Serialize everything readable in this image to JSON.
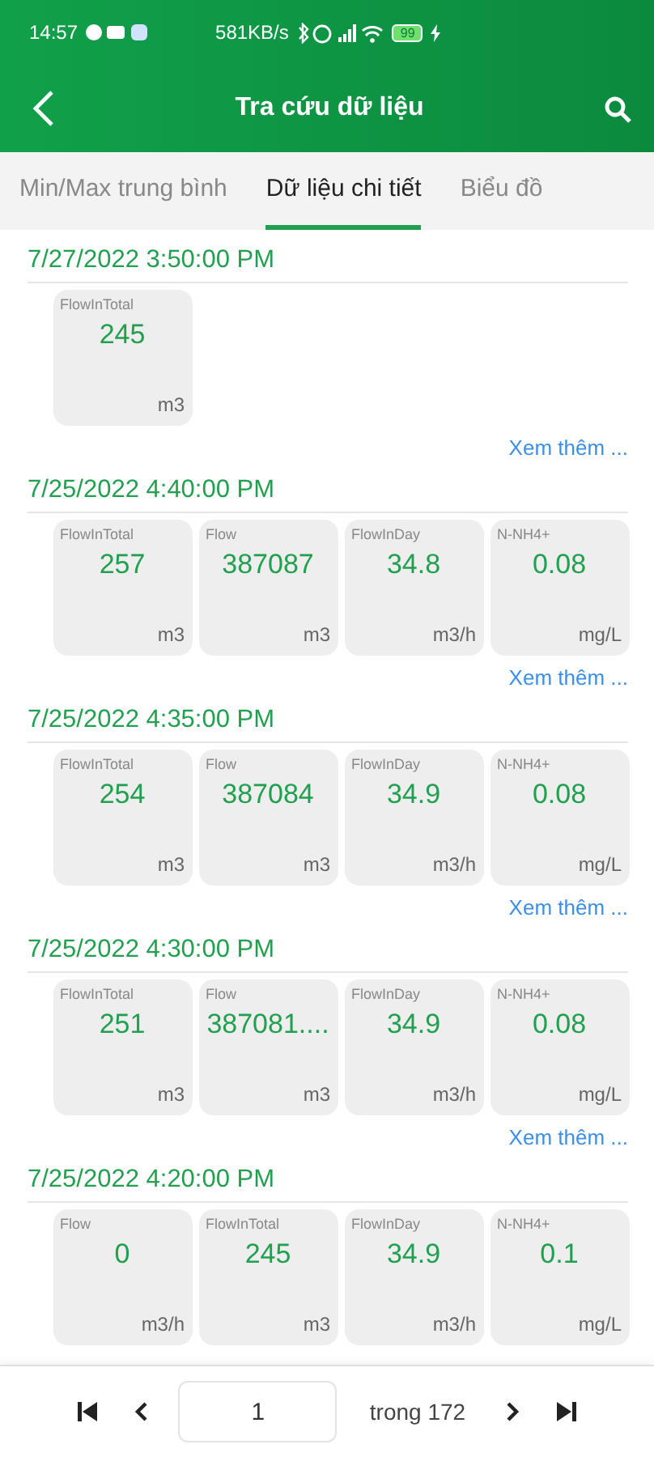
{
  "status_bar": {
    "time": "14:57",
    "speed": "581KB/s",
    "battery": "99"
  },
  "app_bar": {
    "title": "Tra cứu dữ liệu"
  },
  "tabs": [
    {
      "label": "Min/Max trung bình",
      "selected": false
    },
    {
      "label": "Dữ liệu chi tiết",
      "selected": true
    },
    {
      "label": "Biểu đồ",
      "selected": false
    }
  ],
  "records": [
    {
      "timestamp": "7/27/2022 3:50:00 PM",
      "metrics": [
        {
          "name": "FlowInTotal",
          "value": "245",
          "unit": "m3"
        }
      ],
      "more_link": "Xem thêm ..."
    },
    {
      "timestamp": "7/25/2022 4:40:00 PM",
      "metrics": [
        {
          "name": "FlowInTotal",
          "value": "257",
          "unit": "m3"
        },
        {
          "name": "Flow",
          "value": "387087",
          "unit": "m3"
        },
        {
          "name": "FlowInDay",
          "value": "34.8",
          "unit": "m3/h"
        },
        {
          "name": "N-NH4+",
          "value": "0.08",
          "unit": "mg/L"
        }
      ],
      "more_link": "Xem thêm ..."
    },
    {
      "timestamp": "7/25/2022 4:35:00 PM",
      "metrics": [
        {
          "name": "FlowInTotal",
          "value": "254",
          "unit": "m3"
        },
        {
          "name": "Flow",
          "value": "387084",
          "unit": "m3"
        },
        {
          "name": "FlowInDay",
          "value": "34.9",
          "unit": "m3/h"
        },
        {
          "name": "N-NH4+",
          "value": "0.08",
          "unit": "mg/L"
        }
      ],
      "more_link": "Xem thêm ..."
    },
    {
      "timestamp": "7/25/2022 4:30:00 PM",
      "metrics": [
        {
          "name": "FlowInTotal",
          "value": "251",
          "unit": "m3"
        },
        {
          "name": "Flow",
          "value": "387081....",
          "unit": "m3"
        },
        {
          "name": "FlowInDay",
          "value": "34.9",
          "unit": "m3/h"
        },
        {
          "name": "N-NH4+",
          "value": "0.08",
          "unit": "mg/L"
        }
      ],
      "more_link": "Xem thêm ..."
    },
    {
      "timestamp": "7/25/2022 4:20:00 PM",
      "metrics": [
        {
          "name": "Flow",
          "value": "0",
          "unit": "m3/h"
        },
        {
          "name": "FlowInTotal",
          "value": "245",
          "unit": "m3"
        },
        {
          "name": "FlowInDay",
          "value": "34.9",
          "unit": "m3/h"
        },
        {
          "name": "N-NH4+",
          "value": "0.1",
          "unit": "mg/L"
        }
      ]
    }
  ],
  "pager": {
    "page": "1",
    "total": "trong 172"
  }
}
